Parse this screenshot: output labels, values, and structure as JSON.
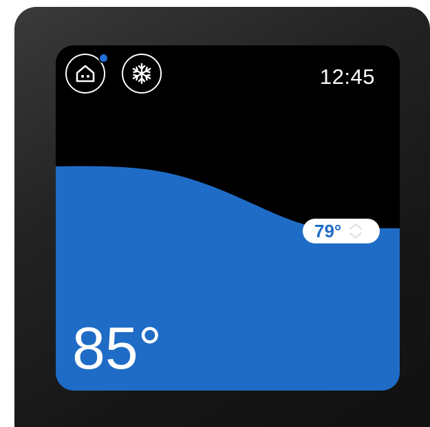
{
  "device": {
    "clock": "12:45",
    "current_temp": "85°",
    "setpoint": "79°",
    "setpoint_fraction": 0.53,
    "mode": "cooling",
    "home_has_notification": true
  },
  "icons": {
    "home": "home-icon",
    "mode": "snowflake-icon",
    "adjust": "chevron-updown-icon"
  },
  "colors": {
    "fill": "#1f6cc6",
    "screen": "#000000",
    "accent_dot": "#1f6fd6"
  }
}
